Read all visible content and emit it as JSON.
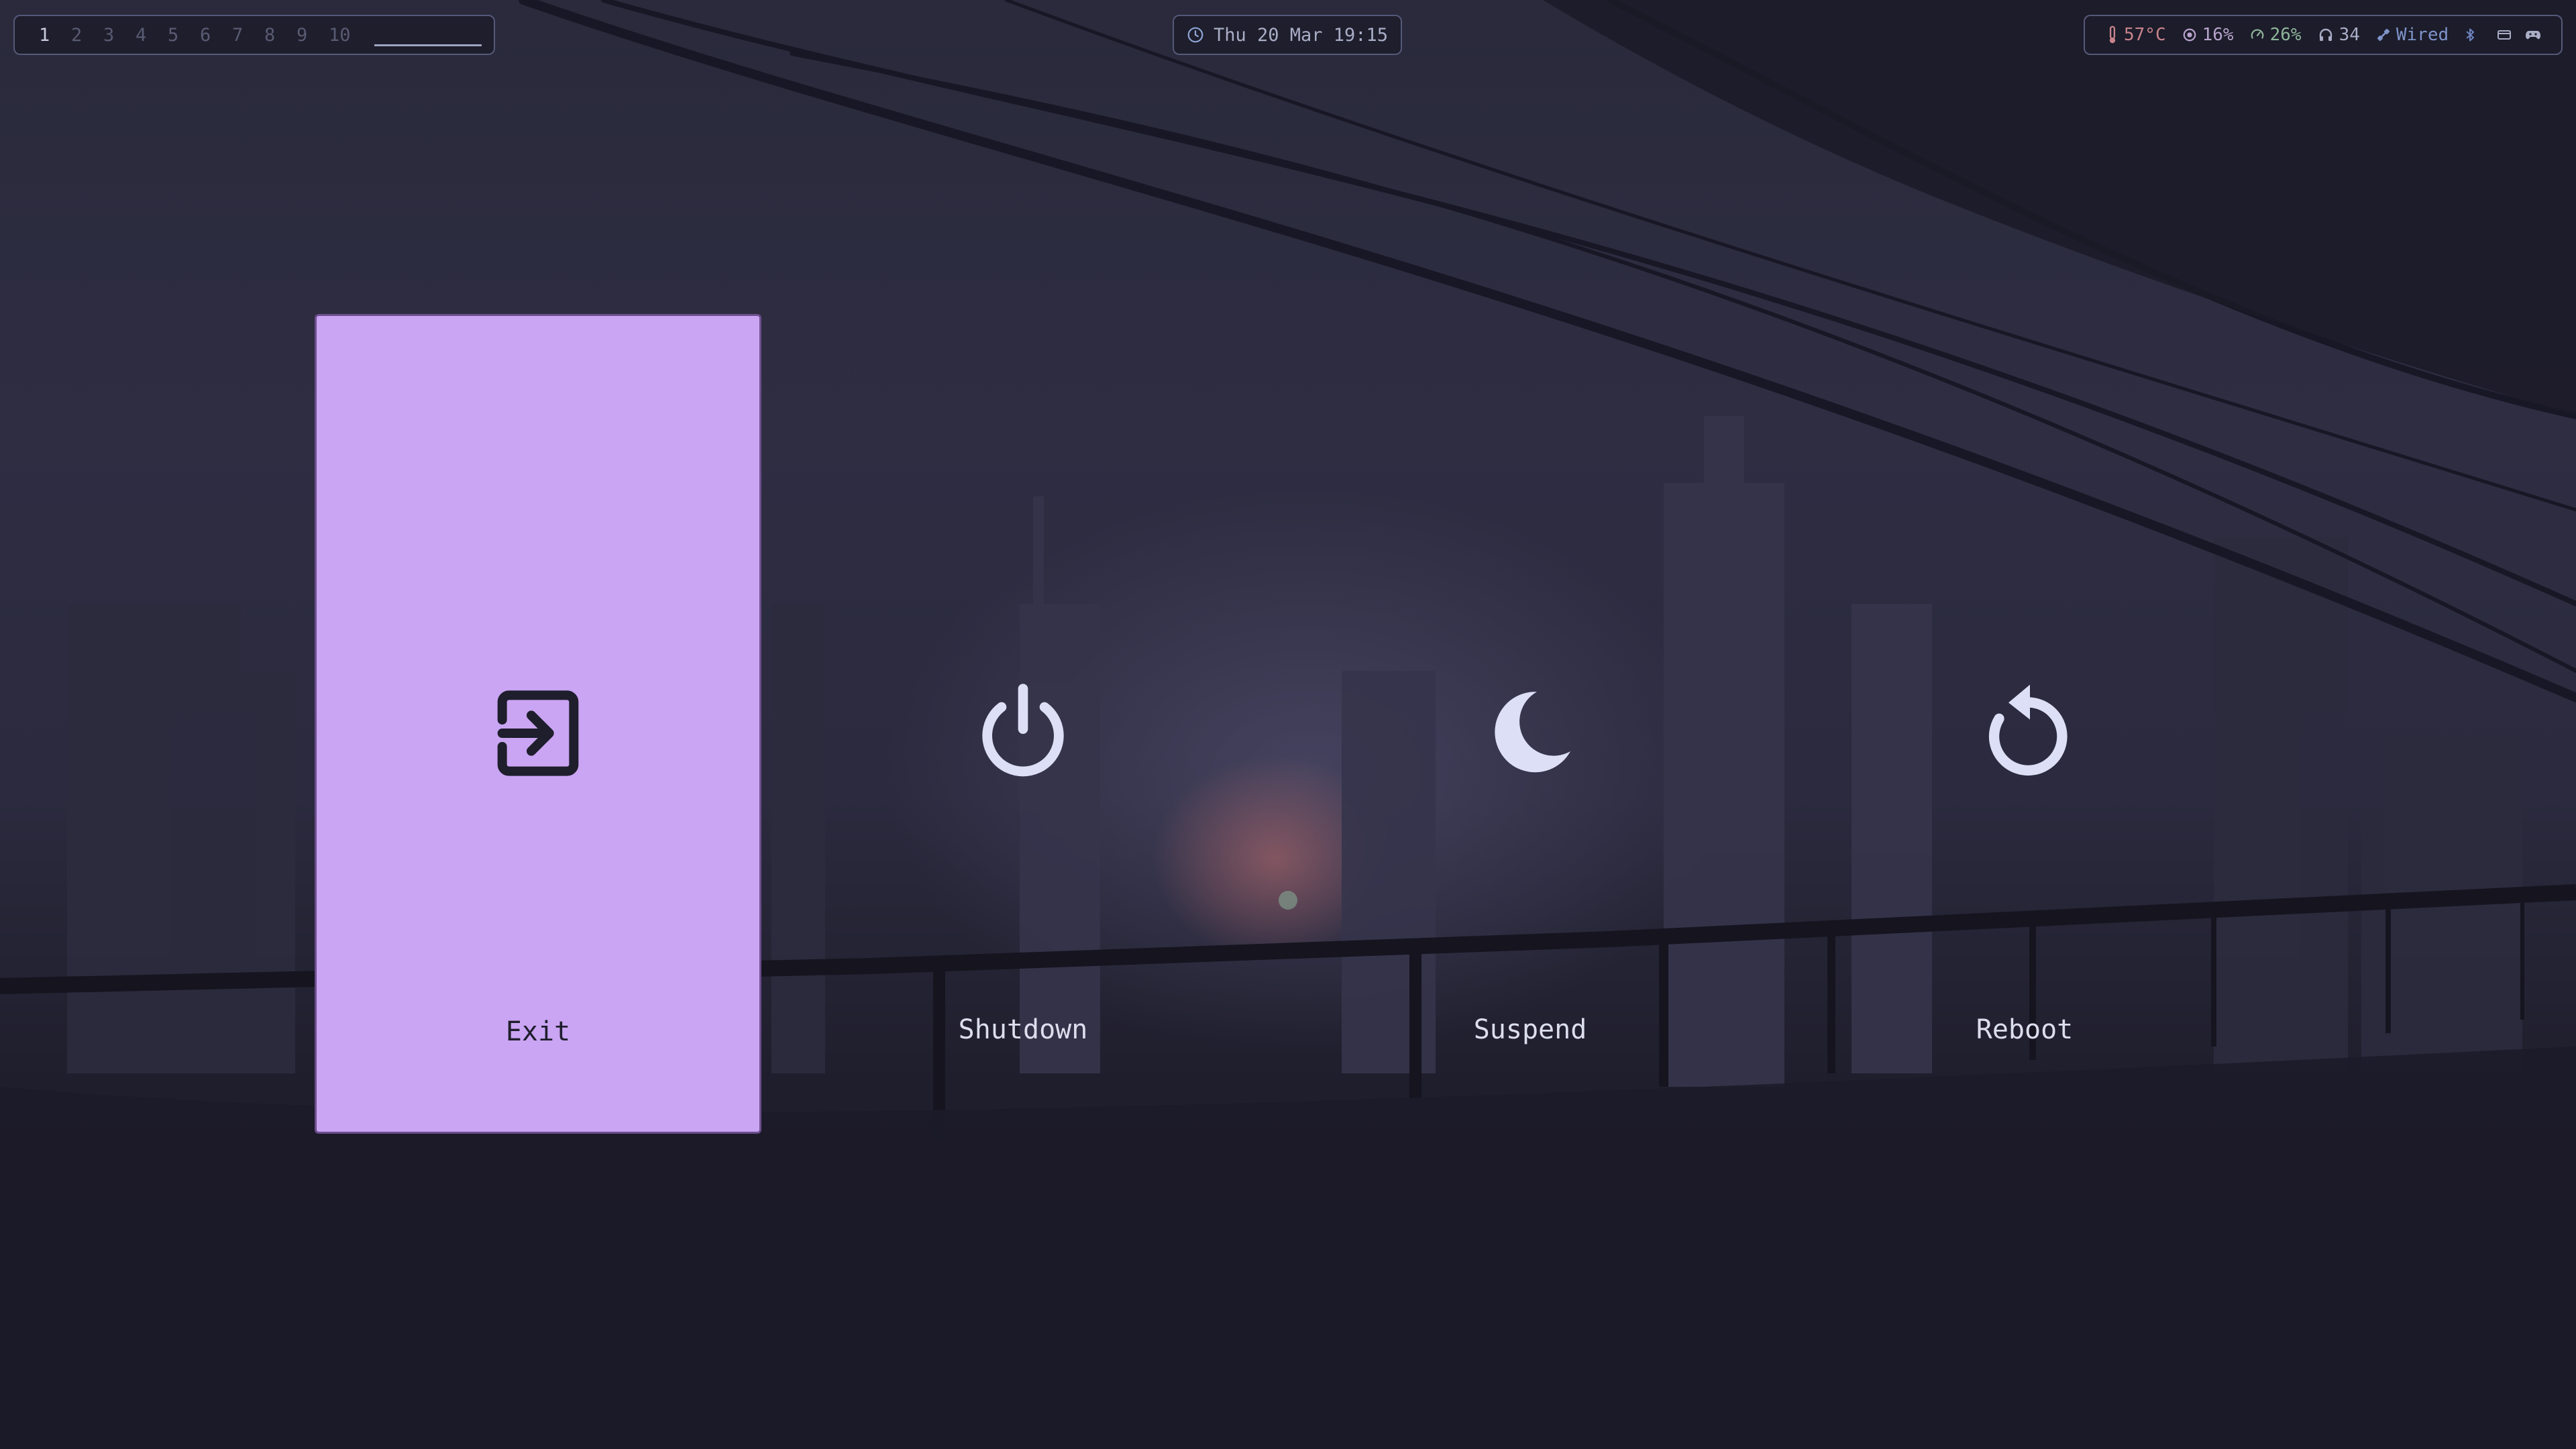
{
  "workspaces": {
    "items": [
      "1",
      "2",
      "3",
      "4",
      "5",
      "6",
      "7",
      "8",
      "9",
      "10"
    ],
    "active": "1"
  },
  "clock": {
    "text": "Thu 20 Mar 19:15",
    "icon": "clock-icon"
  },
  "status": {
    "temperature": "57°C",
    "cpu": "16%",
    "memory": "26%",
    "volume": "34",
    "network": "Wired",
    "icons": [
      "thermometer-icon",
      "cpu-icon",
      "memory-gauge-icon",
      "headphones-icon",
      "ethernet-icon",
      "bluetooth-icon",
      "window-icon",
      "gamepad-icon"
    ]
  },
  "power_menu": {
    "selected": "Exit",
    "options": [
      {
        "label": "Exit",
        "icon": "exit-icon"
      },
      {
        "label": "Shutdown",
        "icon": "power-icon"
      },
      {
        "label": "Suspend",
        "icon": "moon-icon"
      },
      {
        "label": "Reboot",
        "icon": "reboot-icon"
      }
    ]
  },
  "colors": {
    "selected_bg": "#caa5f3",
    "icon_color": "#dcdff5",
    "bar_border": "#55597a",
    "background": "#1c1b28"
  }
}
